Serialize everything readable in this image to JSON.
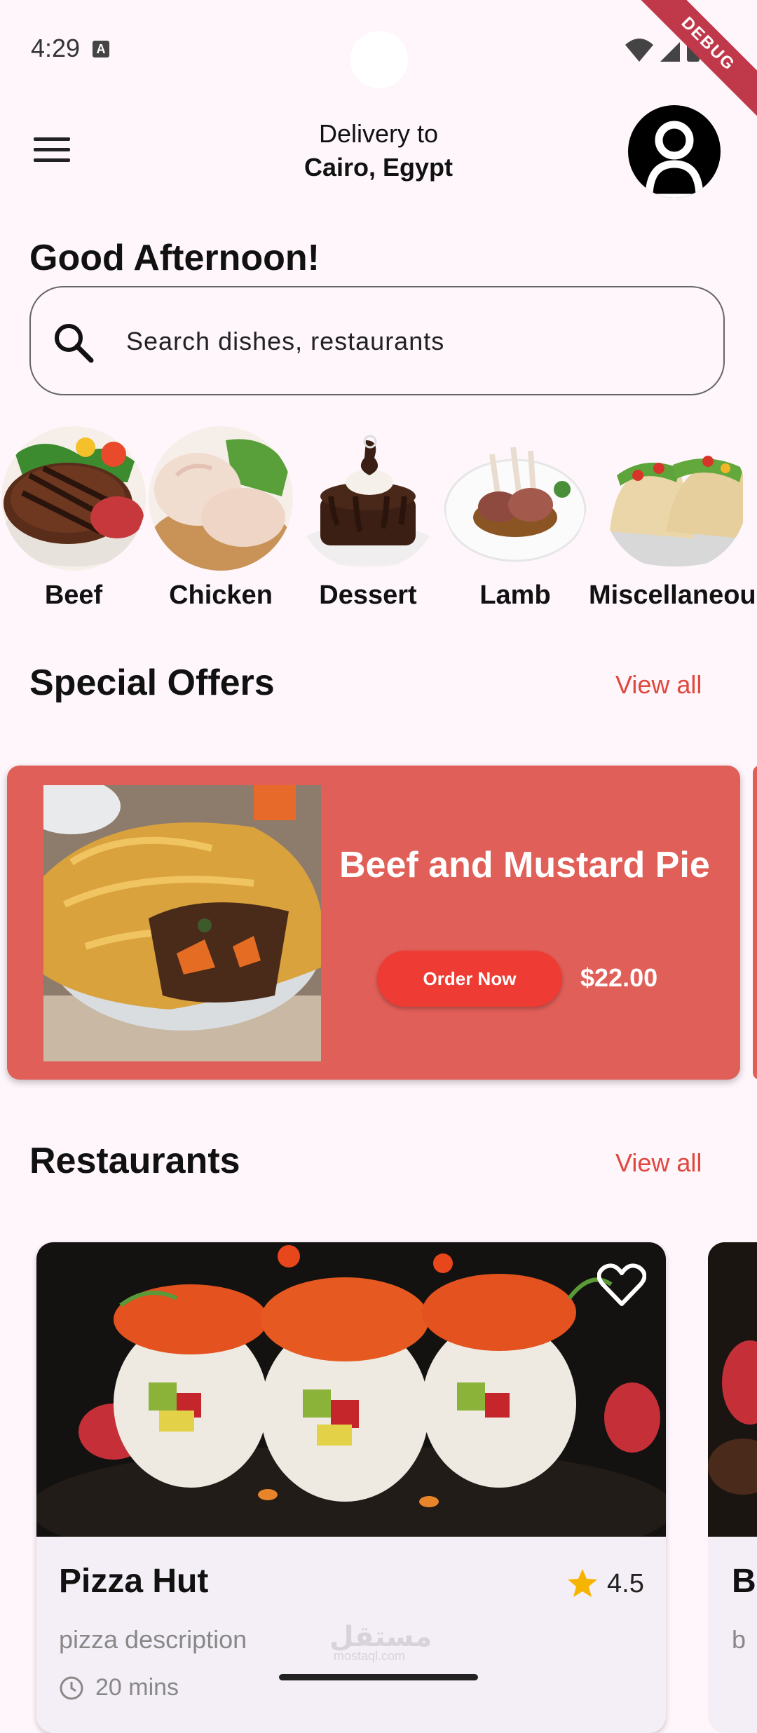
{
  "status_bar": {
    "time": "4:29",
    "notification_glyph": "A",
    "debug_label": "DEBUG"
  },
  "header": {
    "delivery_label": "Delivery to",
    "location": "Cairo, Egypt"
  },
  "greeting": "Good Afternoon!",
  "search": {
    "placeholder": "Search dishes, restaurants"
  },
  "categories": [
    {
      "label": "Beef"
    },
    {
      "label": "Chicken"
    },
    {
      "label": "Dessert"
    },
    {
      "label": "Lamb"
    },
    {
      "label": "Miscellaneous"
    }
  ],
  "special_offers": {
    "title": "Special Offers",
    "view_all": "View all",
    "offer": {
      "name": "Beef and Mustard Pie",
      "button": "Order Now",
      "price": "$22.00"
    }
  },
  "restaurants": {
    "title": "Restaurants",
    "view_all": "View all",
    "items": [
      {
        "name": "Pizza Hut",
        "rating": "4.5",
        "description": "pizza description",
        "time": "20 mins"
      },
      {
        "name": "Bu",
        "description": "b"
      }
    ]
  },
  "watermark": {
    "text": "مستقل",
    "sub": "mostaql.com"
  },
  "colors": {
    "accent": "#e0473d",
    "offer_card": "#e05f58",
    "order_button": "#ee3b34",
    "background": "#fef6fb",
    "star": "#f5b400"
  }
}
